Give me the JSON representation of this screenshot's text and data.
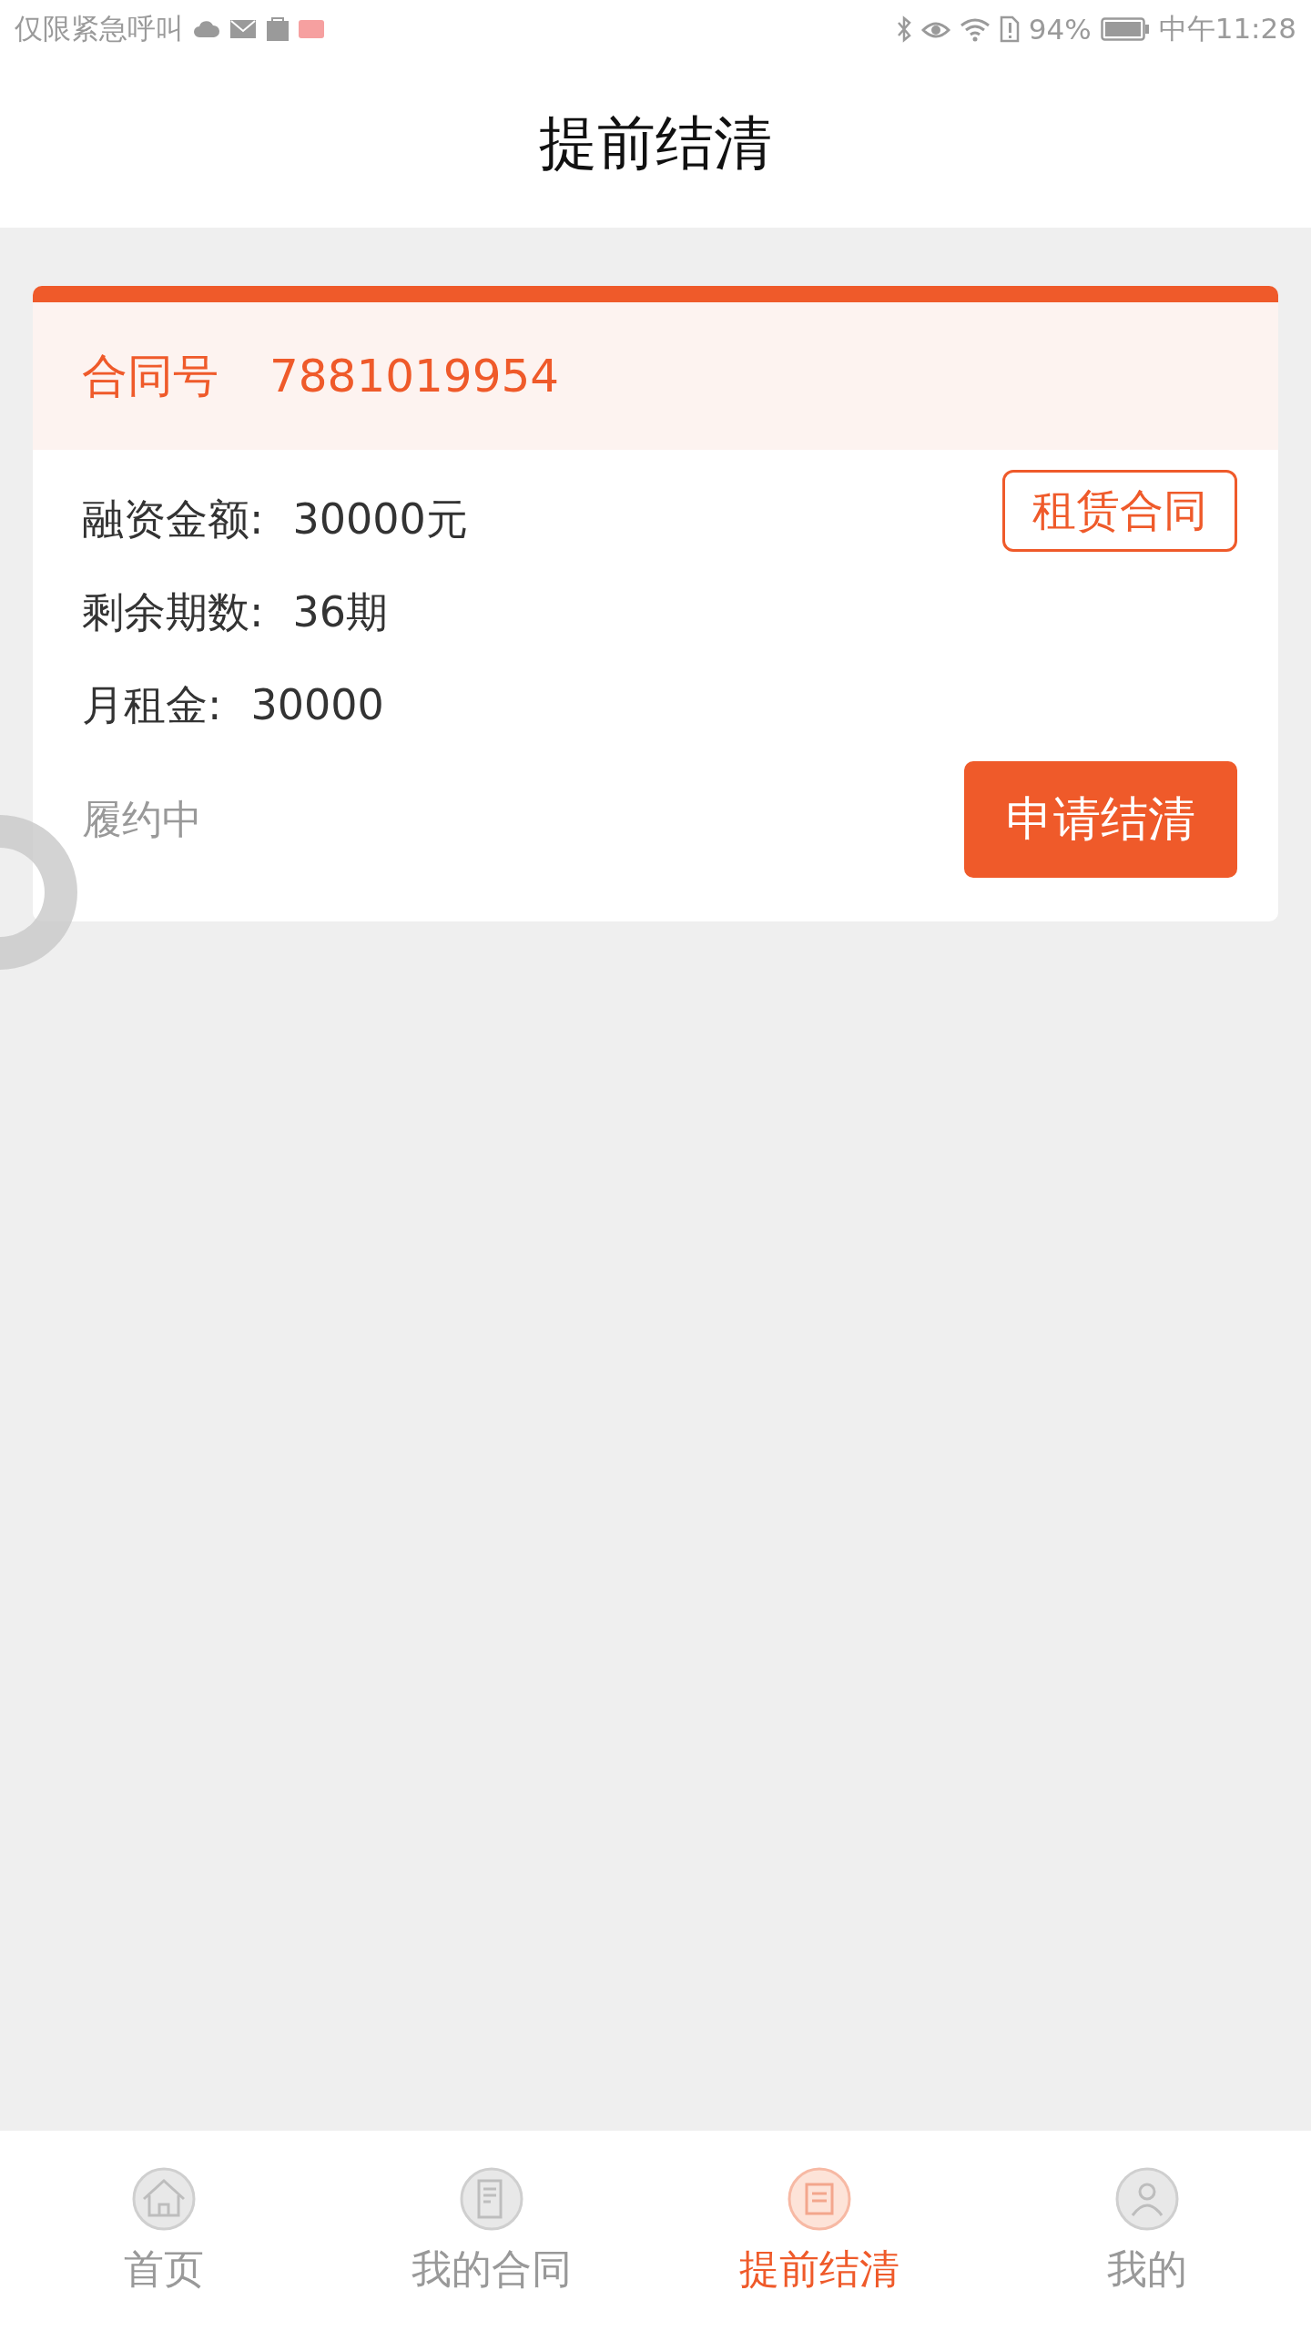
{
  "status_bar": {
    "notice": "仅限紧急呼叫",
    "battery": "94%",
    "time": "中午11:28"
  },
  "header": {
    "title": "提前结清"
  },
  "contract": {
    "number_label": "合同号",
    "number": "7881019954",
    "fields": [
      {
        "label": "融资金额:",
        "value": "30000元"
      },
      {
        "label": "剩余期数:",
        "value": "36期"
      },
      {
        "label": "月租金:",
        "value": "30000"
      }
    ],
    "lease_button": "租赁合同",
    "status": "履约中",
    "settle_button": "申请结清"
  },
  "tabs": [
    {
      "label": "首页",
      "kind": "home",
      "selected": false
    },
    {
      "label": "我的合同",
      "kind": "doc",
      "selected": false
    },
    {
      "label": "提前结清",
      "kind": "settle",
      "selected": true
    },
    {
      "label": "我的",
      "kind": "user",
      "selected": false
    }
  ]
}
